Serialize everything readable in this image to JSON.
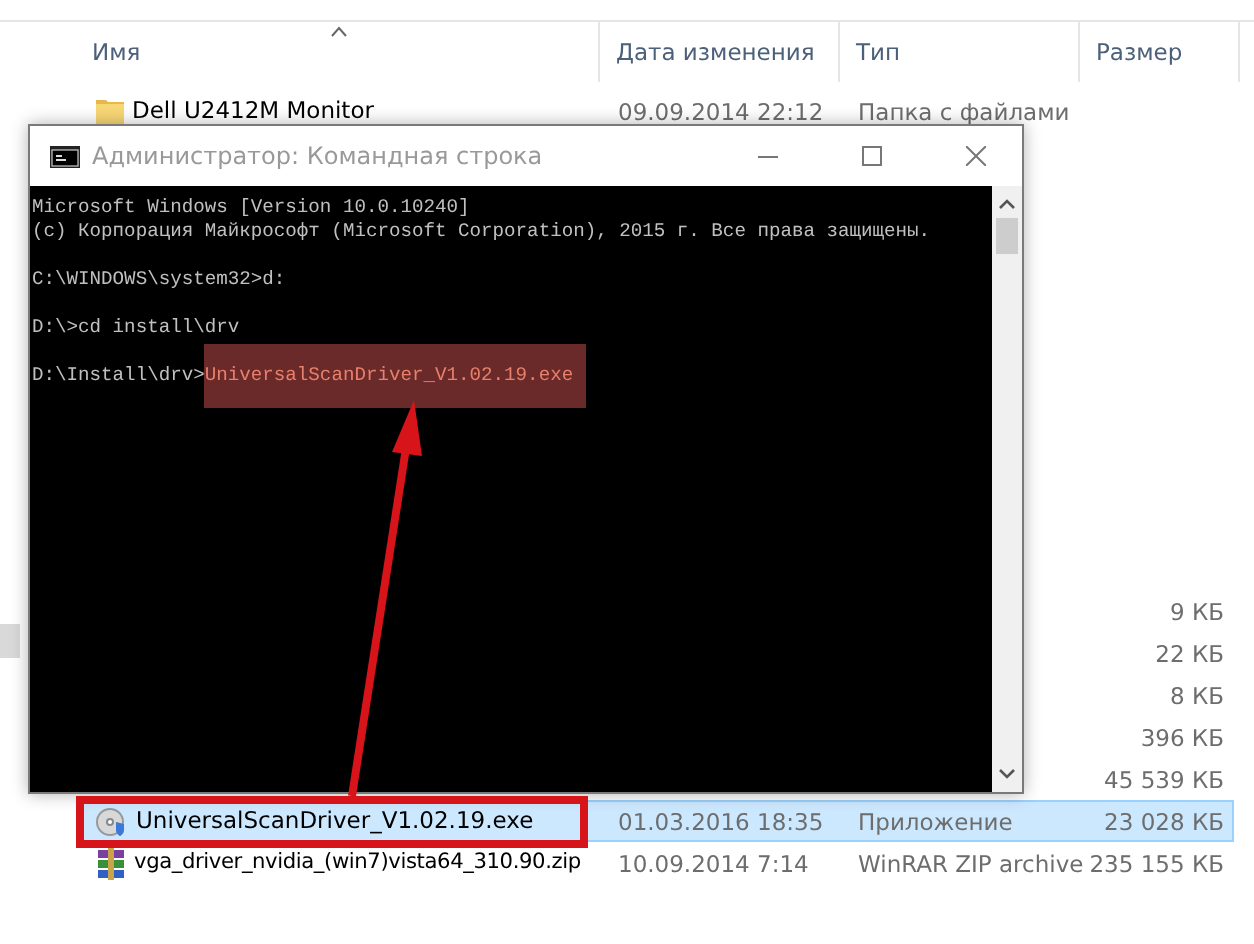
{
  "explorer": {
    "columns": [
      {
        "label": "Имя",
        "sorted": true
      },
      {
        "label": "Дата изменения",
        "sorted": false
      },
      {
        "label": "Тип",
        "sorted": false
      },
      {
        "label": "Размер",
        "sorted": false
      }
    ],
    "top_rows": [
      {
        "name": "Dell U2412M Monitor",
        "date": "09.09.2014 22:12",
        "type": "Папка с файлами",
        "kind": "folder",
        "selected": false
      }
    ],
    "rows": [
      {
        "size": "9 КБ",
        "selected": false
      },
      {
        "size": "22 КБ",
        "selected": false
      },
      {
        "size": "8 КБ",
        "selected": false
      },
      {
        "size": "396 КБ",
        "selected": false
      },
      {
        "size": "45 539 КБ",
        "selected": false
      },
      {
        "name": "UniversalScanDriver_V1.02.19.exe",
        "date": "01.03.2016 18:35",
        "type": "Приложение",
        "size": "23 028 КБ",
        "kind": "installer",
        "selected": true
      },
      {
        "name": "vga_driver_nvidia_(win7)vista64_310.90.zip",
        "date": "10.09.2014 7:14",
        "type": "WinRAR ZIP archive",
        "size": "235 155 КБ",
        "kind": "archive",
        "selected": false
      }
    ]
  },
  "console": {
    "title": "Администратор: Командная строка",
    "lines": [
      {
        "text": "Microsoft Windows [Version 10.0.10240]"
      },
      {
        "text": "(c) Корпорация Майкрософт (Microsoft Corporation), 2015 г. Все права защищены."
      },
      {
        "kind": "blank"
      },
      {
        "text": "C:\\WINDOWS\\system32>d:"
      },
      {
        "kind": "blank"
      },
      {
        "text": "D:\\>cd install\\drv"
      },
      {
        "kind": "blank"
      },
      {
        "text": "D:\\Install\\drv>",
        "command": "UniversalScanDriver_V1.02.19.exe",
        "highlighted": true
      }
    ]
  }
}
